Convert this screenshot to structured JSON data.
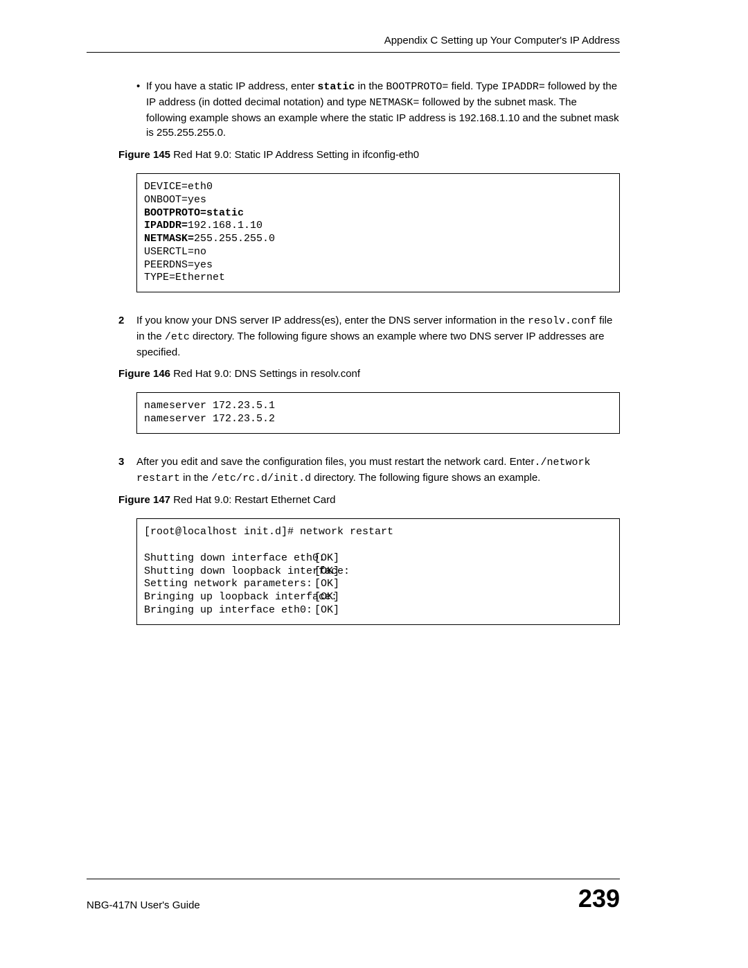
{
  "header": {
    "text": "Appendix C Setting up Your Computer's IP Address"
  },
  "bullet": {
    "mark": "•",
    "pre1": "If you have a static IP address, enter ",
    "code1": "static",
    "mid1": " in the ",
    "code2": "BOOTPROTO=",
    "mid2": " field. Type ",
    "code3": "IPADDR=",
    "mid3": " followed by the IP address (in dotted decimal notation) and type ",
    "code4": "NETMASK=",
    "mid4": " followed by the subnet mask. The following example shows an example where the static IP address is 192.168.1.10 and the subnet mask is 255.255.255.0."
  },
  "fig145": {
    "label": "Figure 145",
    "title": "   Red Hat 9.0: Static IP Address Setting in ifconfig-eth0"
  },
  "code145": {
    "l1": "DEVICE=eth0",
    "l2": "ONBOOT=yes",
    "l3a": "BOOTPROTO=static",
    "l4a": "IPADDR=",
    "l4b": "192.168.1.10",
    "l5a": "NETMASK=",
    "l5b": "255.255.255.0",
    "l6": "USERCTL=no",
    "l7": "PEERDNS=yes",
    "l8": "TYPE=Ethernet"
  },
  "step2": {
    "num": "2",
    "pre1": "If you know your DNS server IP address(es), enter the DNS server information in the ",
    "code1": "resolv.conf",
    "mid1": " file in the ",
    "code2": "/etc",
    "post1": " directory. The following figure shows an example where two DNS server IP addresses are specified."
  },
  "fig146": {
    "label": "Figure 146",
    "title": "   Red Hat 9.0: DNS Settings in resolv.conf"
  },
  "code146": {
    "l1": "nameserver 172.23.5.1",
    "l2": "nameserver 172.23.5.2"
  },
  "step3": {
    "num": "3",
    "pre1": "After you edit and save the configuration files, you must restart the network card. Enter",
    "code1": "./network restart",
    "mid1": " in the ",
    "code2": "/etc/rc.d/init.d",
    "post1": " directory. The following figure shows an example."
  },
  "fig147": {
    "label": "Figure 147",
    "title": "   Red Hat 9.0: Restart Ethernet Card"
  },
  "code147": {
    "l1": "[root@localhost init.d]# network restart",
    "r1a": "Shutting down interface eth0:",
    "r1b": "[OK]",
    "r2a": "Shutting down loopback interface:",
    "r2b": "[OK]",
    "r3a": "Setting network parameters:",
    "r3b": "[OK]",
    "r4a": "Bringing up loopback interface:",
    "r4b": "[OK]",
    "r5a": "Bringing up interface eth0:",
    "r5b": "[OK]"
  },
  "footer": {
    "guide": "NBG-417N User's Guide",
    "page": "239"
  }
}
